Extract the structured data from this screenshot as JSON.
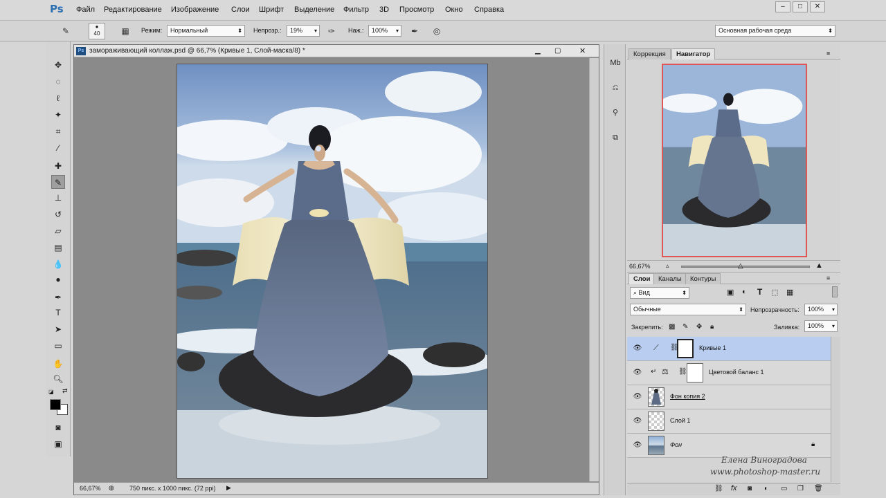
{
  "app": {
    "logo": "Ps",
    "menu": [
      "Файл",
      "Редактирование",
      "Изображение",
      "Слои",
      "Шрифт",
      "Выделение",
      "Фильтр",
      "3D",
      "Просмотр",
      "Окно",
      "Справка"
    ]
  },
  "options": {
    "brush_size": "40",
    "mode_label": "Режим:",
    "mode_value": "Нормальный",
    "opacity_label": "Непрозр.:",
    "opacity_value": "19%",
    "pressure_label": "Наж.:",
    "pressure_value": "100%",
    "workspace": "Основная рабочая среда"
  },
  "document": {
    "title": "замораживающий коллаж.psd @ 66,7% (Кривые 1, Слой-маска/8) *",
    "zoom": "66,67%",
    "doc_info": "750 пикс. x 1000 пикс. (72 ppi)"
  },
  "navigator": {
    "tabs": [
      "Коррекция",
      "Навигатор"
    ],
    "zoom": "66,67%"
  },
  "layers_panel": {
    "tabs": [
      "Слои",
      "Каналы",
      "Контуры"
    ],
    "filter_value": "Вид",
    "blend_mode": "Обычные",
    "opacity_label": "Непрозрачность:",
    "opacity_value": "100%",
    "lock_label": "Закрепить:",
    "fill_label": "Заливка:",
    "fill_value": "100%",
    "layers": [
      {
        "name": "Кривые 1"
      },
      {
        "name": "Цветовой баланс 1"
      },
      {
        "name": "Фон копия 2"
      },
      {
        "name": "Слой 1"
      },
      {
        "name": "Фон"
      }
    ]
  },
  "watermark": {
    "author": "Елена Виноградова",
    "site": "www.photoshop-master.ru"
  },
  "colors": {
    "selected_layer": "#b9cdf0",
    "navigator_frame": "#e05555"
  }
}
